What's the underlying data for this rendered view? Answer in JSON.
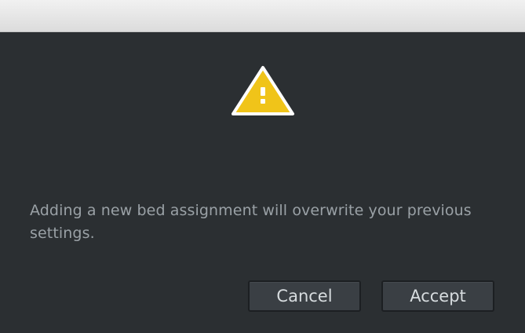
{
  "window": {
    "title": ""
  },
  "dialog": {
    "icon": "warning-icon",
    "icon_color": "#f0c419",
    "message": "Adding a new bed assignment will overwrite your previous settings.",
    "buttons": {
      "cancel_label": "Cancel",
      "accept_label": "Accept"
    }
  }
}
